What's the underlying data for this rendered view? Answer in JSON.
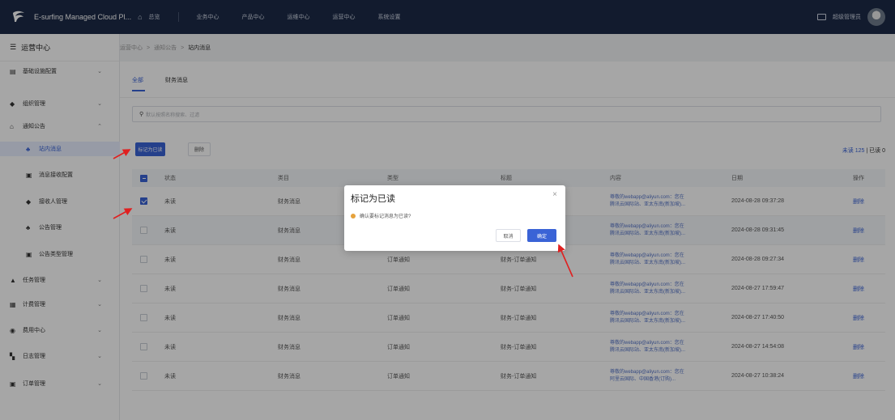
{
  "topbar": {
    "app_title": "E-surfing Managed Cloud Pl...",
    "nav": [
      "总览",
      "业务中心",
      "产品中心",
      "运维中心",
      "运营中心",
      "系统设置"
    ],
    "admin": "超级管理员"
  },
  "sidebar": {
    "header": "运营中心",
    "items": [
      {
        "label": "基础设施配置",
        "icon": "server-icon",
        "expandable": true
      },
      {
        "label": "组织管理",
        "icon": "org-icon",
        "expandable": true
      },
      {
        "label": "通知公告",
        "icon": "bank-icon",
        "expandable": true,
        "expanded": true
      },
      {
        "label": "站内消息",
        "icon": "users-icon",
        "active": true
      },
      {
        "label": "消息接收配置",
        "icon": "doc-icon"
      },
      {
        "label": "接收人管理",
        "icon": "user-icon"
      },
      {
        "label": "公告管理",
        "icon": "users-icon"
      },
      {
        "label": "公告类型管理",
        "icon": "doc-icon"
      },
      {
        "label": "任务管理",
        "icon": "task-icon",
        "expandable": true
      },
      {
        "label": "计费管理",
        "icon": "bill-icon",
        "expandable": true
      },
      {
        "label": "费用中心",
        "icon": "coin-icon",
        "expandable": true
      },
      {
        "label": "日志管理",
        "icon": "log-icon",
        "expandable": true
      },
      {
        "label": "订单管理",
        "icon": "order-icon",
        "expandable": true
      }
    ]
  },
  "breadcrumb": [
    "运营中心",
    ">",
    "通知公告",
    ">",
    "站内消息"
  ],
  "tabs": [
    "全部",
    "财务消息"
  ],
  "search": {
    "placeholder": "默认按照名称搜索、过滤"
  },
  "toolbar": {
    "mark_read": "标记为已读",
    "delete": "删除"
  },
  "counts": {
    "unread": "未读 125",
    "read": "已读 0"
  },
  "table": {
    "headers": [
      "状态",
      "类目",
      "类型",
      "标题",
      "内容",
      "日期",
      "操作"
    ],
    "rows": [
      {
        "checked": true,
        "status": "未读",
        "category": "财务消息",
        "type": "",
        "title": "",
        "content1": "尊敬的webapp@aliyun.com：您在",
        "content2": "腾讯云国际站、亚太东南(新加坡)...",
        "date": "2024-08-28 09:37:28",
        "op": "删除"
      },
      {
        "checked": false,
        "status": "未读",
        "category": "财务消息",
        "type": "",
        "title": "",
        "content1": "尊敬的webapp@aliyun.com：您在",
        "content2": "腾讯云国际站、亚太东南(新加坡)...",
        "date": "2024-08-28 09:31:45",
        "op": "删除"
      },
      {
        "checked": false,
        "status": "未读",
        "category": "财务消息",
        "type": "订单通知",
        "title": "财务-订单通知",
        "content1": "尊敬的webapp@aliyun.com：您在",
        "content2": "腾讯云国际站、亚太东南(新加坡)...",
        "date": "2024-08-28 09:27:34",
        "op": "删除"
      },
      {
        "checked": false,
        "status": "未读",
        "category": "财务消息",
        "type": "订单通知",
        "title": "财务-订单通知",
        "content1": "尊敬的webapp@aliyun.com：您在",
        "content2": "腾讯云国际站、亚太东南(新加坡)...",
        "date": "2024-08-27 17:59:47",
        "op": "删除"
      },
      {
        "checked": false,
        "status": "未读",
        "category": "财务消息",
        "type": "订单通知",
        "title": "财务-订单通知",
        "content1": "尊敬的webapp@aliyun.com：您在",
        "content2": "腾讯云国际站、亚太东南(新加坡)...",
        "date": "2024-08-27 17:40:50",
        "op": "删除"
      },
      {
        "checked": false,
        "status": "未读",
        "category": "财务消息",
        "type": "订单通知",
        "title": "财务-订单通知",
        "content1": "尊敬的webapp@aliyun.com：您在",
        "content2": "腾讯云国际站、亚太东南(新加坡)...",
        "date": "2024-08-27 14:54:08",
        "op": "删除"
      },
      {
        "checked": false,
        "status": "未读",
        "category": "财务消息",
        "type": "订单通知",
        "title": "财务-订单通知",
        "content1": "尊敬的webapp@aliyun.com：您在",
        "content2": "阿里云国际、中国香港(订购)...",
        "date": "2024-08-27 10:38:24",
        "op": "删除"
      }
    ]
  },
  "dialog": {
    "title": "标记为已读",
    "message": "确认要标记消息为已读?",
    "cancel": "取消",
    "ok": "确定"
  },
  "colors": {
    "accent": "#3a63d6",
    "topbar": "#1c2a47",
    "warning": "#e6a23c",
    "annotation": "#e02020"
  }
}
